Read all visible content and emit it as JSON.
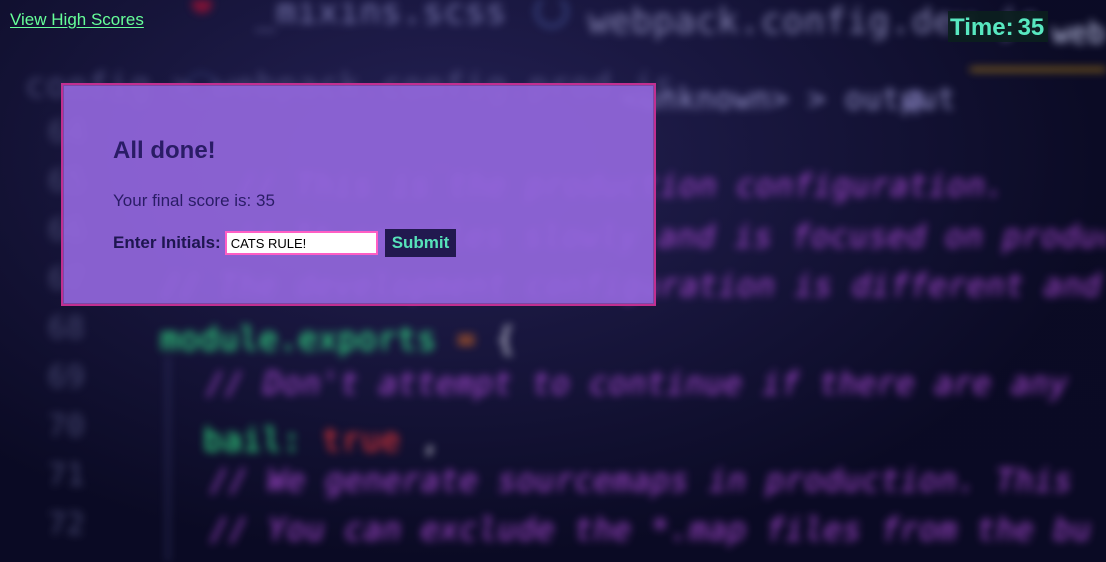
{
  "header": {
    "high_scores_link": "View High Scores",
    "timer_label": "Time:",
    "timer_value": "35"
  },
  "dialog": {
    "title": "All done!",
    "score_label": "Your final score is:",
    "score_value": "35",
    "initials_label": "Enter Initials:",
    "initials_value": "CATS RULE!",
    "submit_label": "Submit"
  },
  "background_code": {
    "tab_left": "_mixins.scss",
    "tab_middle": "webpack.config.dev.js",
    "tab_right": "web",
    "breadcrumb_left": "config > webpack.config.prod.js",
    "breadcrumb_right": "<unknown> > output",
    "line_numbers": "64\n65\n66\n67\n68\n69\n70\n71\n72",
    "comment_line_1": "// This is the production configuration.",
    "comment_line_2": "// It compiles slowly and is focused on producing",
    "comment_line_3": "// The development configuration is different and",
    "code_line_1_start": "module.exports",
    "code_line_1_operator": "=",
    "code_line_1_brace": "{",
    "comment_line_4": "// Don't attempt to continue if there are any",
    "code_line_2_key": "bail:",
    "code_line_2_value": "true",
    "code_line_2_comma": ",",
    "comment_line_5": "// We generate sourcemaps in production. This",
    "comment_line_6": "// You can exclude the *.map files from the bu"
  },
  "colors": {
    "link": "#66ff99",
    "timer": "#58e8c0",
    "dialog_background": "#9367dc",
    "dialog_border": "#c12f91",
    "submit_background": "#22194f",
    "submit_text": "#57e3ba"
  },
  "icons": {
    "settings": "gear-icon",
    "webpack": "webpack-icon",
    "wrench": "wrench-icon"
  }
}
